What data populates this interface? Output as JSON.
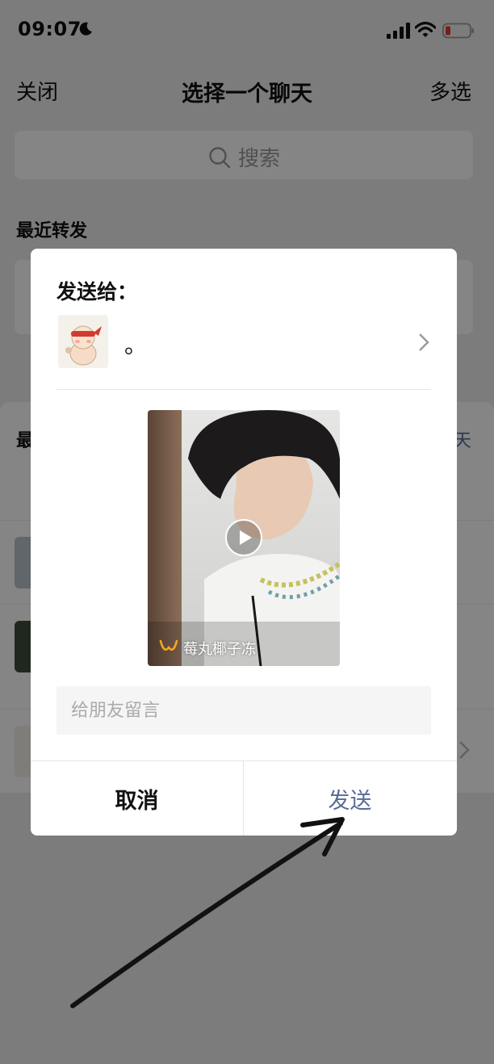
{
  "status_bar": {
    "time": "09:07",
    "moon_icon": "moon-icon",
    "signal_icon": "signal-icon",
    "wifi_icon": "wifi-icon",
    "battery_icon": "battery-low-icon",
    "battery_color": "#e53935"
  },
  "nav": {
    "close_label": "关闭",
    "title": "选择一个聊天",
    "multi_select_label": "多选"
  },
  "search": {
    "placeholder": "搜索",
    "icon": "search-icon"
  },
  "recent_forward": {
    "header": "最近转发"
  },
  "lower_section": {
    "header_visible": "最",
    "more_visible": "天"
  },
  "dialog": {
    "title": "发送给：",
    "recipient": {
      "name": "。",
      "avatar_icon": "cartoon-character-avatar",
      "chevron_icon": "chevron-right-icon"
    },
    "video": {
      "channel_name": "莓丸椰子冻",
      "channel_logo": "channels-logo-icon",
      "play_icon": "play-icon"
    },
    "message_placeholder": "给朋友留言",
    "cancel_label": "取消",
    "send_label": "发送",
    "send_color": "#576b95"
  },
  "annotation": {
    "arrow_icon": "hand-drawn-arrow-icon"
  }
}
